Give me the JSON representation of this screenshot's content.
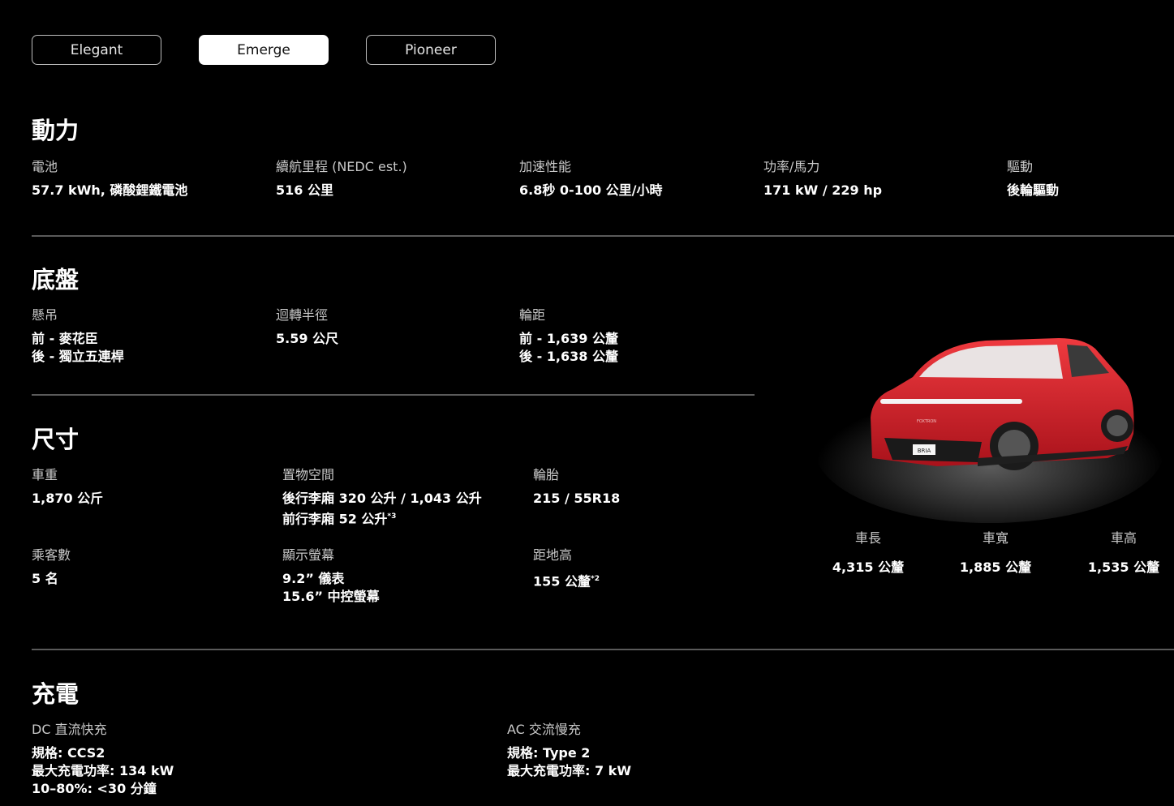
{
  "tabs": [
    "Elegant",
    "Emerge",
    "Pioneer"
  ],
  "active_tab": "Emerge",
  "power": {
    "title": "動力",
    "specs": [
      {
        "label": "電池",
        "value": "57.7 kWh, 磷酸鋰鐵電池"
      },
      {
        "label": "續航里程 (NEDC est.)",
        "value": "516 公里"
      },
      {
        "label": "加速性能",
        "value": "6.8秒 0-100 公里/小時"
      },
      {
        "label": "功率/馬力",
        "value": "171 kW / 229 hp"
      },
      {
        "label": "驅動",
        "value": "後輪驅動"
      }
    ]
  },
  "chassis": {
    "title": "底盤",
    "specs": [
      {
        "label": "懸吊",
        "lines": [
          "前 - 麥花臣",
          "後 - 獨立五連桿"
        ]
      },
      {
        "label": "迴轉半徑",
        "lines": [
          "5.59 公尺"
        ]
      },
      {
        "label": "輪距",
        "lines": [
          "前 - 1,639 公釐",
          "後 - 1,638 公釐"
        ]
      }
    ]
  },
  "dimensions": {
    "title": "尺寸",
    "specs": [
      {
        "label": "車重",
        "lines": [
          "1,870 公斤"
        ]
      },
      {
        "label": "置物空間",
        "lines": [
          "後行李廂 320 公升 / 1,043 公升",
          "前行李廂 52 公升"
        ],
        "note": "*3"
      },
      {
        "label": "輪胎",
        "lines": [
          "215 / 55R18"
        ]
      },
      {
        "label": "乘客數",
        "lines": [
          "5 名"
        ]
      },
      {
        "label": "顯示螢幕",
        "lines": [
          "9.2” 儀表",
          "15.6” 中控螢幕"
        ]
      },
      {
        "label": "距地高",
        "lines": [
          "155 公釐"
        ],
        "note": "*2"
      }
    ],
    "car": [
      {
        "label": "車長",
        "value": "4,315 公釐"
      },
      {
        "label": "車寬",
        "value": "1,885 公釐"
      },
      {
        "label": "車高",
        "value": "1,535 公釐"
      }
    ],
    "car_plate": "BRIA",
    "car_brand": "FOXTRON"
  },
  "charging": {
    "title": "充電",
    "specs": [
      {
        "label": "DC 直流快充",
        "lines": [
          "規格: CCS2",
          "最大充電功率: 134 kW",
          "10–80%: <30 分鐘"
        ]
      },
      {
        "label": "AC 交流慢充",
        "lines": [
          "規格: Type 2",
          "最大充電功率: 7 kW"
        ]
      }
    ]
  },
  "colors": {
    "car_red": "#d01a24",
    "divider": "#5a5a5a"
  }
}
